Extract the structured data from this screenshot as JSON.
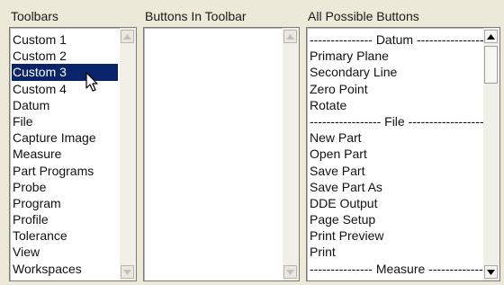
{
  "headers": {
    "toolbars": "Toolbars",
    "buttons_in_toolbar": "Buttons In Toolbar",
    "all_possible_buttons": "All Possible Buttons"
  },
  "toolbars": {
    "selected_index": 2,
    "items": [
      "Custom 1",
      "Custom 2",
      "Custom 3",
      "Custom 4",
      "Datum",
      "File",
      "Capture Image",
      "Measure",
      "Part Programs",
      "Probe",
      "Program",
      "Profile",
      "Tolerance",
      "View",
      "Workspaces"
    ]
  },
  "buttons_in_toolbar": {
    "items": []
  },
  "all_possible_buttons": {
    "items": [
      "--------------- Datum ----------------------",
      "Primary Plane",
      "Secondary Line",
      "Zero Point",
      "Rotate",
      "----------------- File --------------------",
      "New Part",
      "Open Part",
      "Save Part",
      "Save Part As",
      "DDE Output",
      "Page Setup",
      "Print Preview",
      "Print",
      "--------------- Measure -------------------"
    ]
  },
  "colors": {
    "selection": "#0a246a",
    "window_bg": "#ece9d8"
  },
  "icons": {
    "scroll_up": "up-arrow-icon",
    "scroll_down": "down-arrow-icon",
    "pointer": "mouse-pointer-icon"
  }
}
